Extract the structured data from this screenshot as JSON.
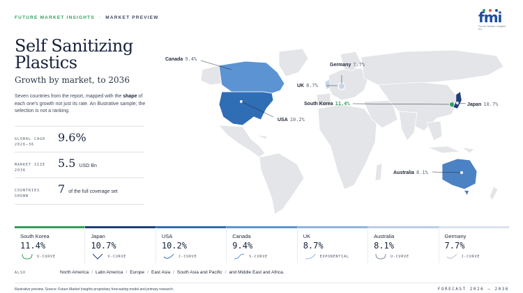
{
  "header": {
    "brand": "FUTURE MARKET INSIGHTS",
    "separator": "·",
    "section": "MARKET PREVIEW"
  },
  "logo": {
    "wordmark": "fmi",
    "tagline": "Future Market Insights Inc.",
    "dot_colors": [
      "#2f9e5a",
      "#e2574c",
      "#1e4e9c"
    ]
  },
  "title": "Self Sanitizing Plastics",
  "subtitle": "Growth by market, to 2036",
  "description": {
    "before": "Seven countries from the report, mapped with the ",
    "bold": "shape",
    "after": " of each one's growth not just its rate. An illustrative sample; the selection is not a ranking."
  },
  "stats": [
    {
      "key_line1": "GLOBAL CAGR",
      "key_line2": "2026–36",
      "value": "9.6%",
      "unit": ""
    },
    {
      "key_line1": "MARKET SIZE",
      "key_line2": "2036",
      "value": "5.5",
      "unit": "USD Bn"
    },
    {
      "key_line1": "COUNTRIES",
      "key_line2": "SHOWN",
      "value": "7",
      "unit": "of the full coverage set"
    }
  ],
  "map_labels": {
    "canada": {
      "name": "Canada",
      "value": "9.4%"
    },
    "germany": {
      "name": "Germany",
      "value": "7.7%"
    },
    "uk": {
      "name": "UK",
      "value": "8.7%"
    },
    "south_korea": {
      "name": "South Korea",
      "value": "11.4%"
    },
    "japan": {
      "name": "Japan",
      "value": "10.7%"
    },
    "usa": {
      "name": "USA",
      "value": "10.2%"
    },
    "australia": {
      "name": "Australia",
      "value": "8.1%"
    }
  },
  "colors": {
    "land": "#e3e5e8",
    "usa": "#2f6db5",
    "canada": "#5b93d3",
    "australia": "#4b82c3",
    "japan": "#1e3f7a",
    "highlight_green": "#2f9e5a"
  },
  "cards": [
    {
      "name": "South Korea",
      "pct": "11.4%",
      "curve": "U-CURVE",
      "curve_icon": "u-curve",
      "accent": "#2f9e5a"
    },
    {
      "name": "Japan",
      "pct": "10.7%",
      "curve": "V-CURVE",
      "curve_icon": "v-curve",
      "accent": "#1e3f7a"
    },
    {
      "name": "USA",
      "pct": "10.2%",
      "curve": "J-CURVE",
      "curve_icon": "j-curve",
      "accent": "#2f6db5"
    },
    {
      "name": "Canada",
      "pct": "9.4%",
      "curve": "S-CURVE",
      "curve_icon": "s-curve",
      "accent": "#5b93d3"
    },
    {
      "name": "UK",
      "pct": "8.7%",
      "curve": "EXPONENTIAL",
      "curve_icon": "exponential-curve",
      "accent": "#8fb4e0"
    },
    {
      "name": "Australia",
      "pct": "8.1%",
      "curve": "U-CURVE",
      "curve_icon": "u-curve",
      "accent": "#b9cde6"
    },
    {
      "name": "Germany",
      "pct": "7.7%",
      "curve": "J-CURVE",
      "curve_icon": "j-curve",
      "accent": "#d9e2ed"
    }
  ],
  "also": {
    "label": "ALSO",
    "regions": [
      "North America",
      "Latin America",
      "Europe",
      "East Asia",
      "South Asia and Pacific",
      "and Middle East and Africa."
    ],
    "separator": "/"
  },
  "footer": {
    "source": "Illustrative preview. Source: Future Market Insights proprietary forecasting model and primary research.",
    "forecast": "FORECAST 2026 – 2036"
  }
}
